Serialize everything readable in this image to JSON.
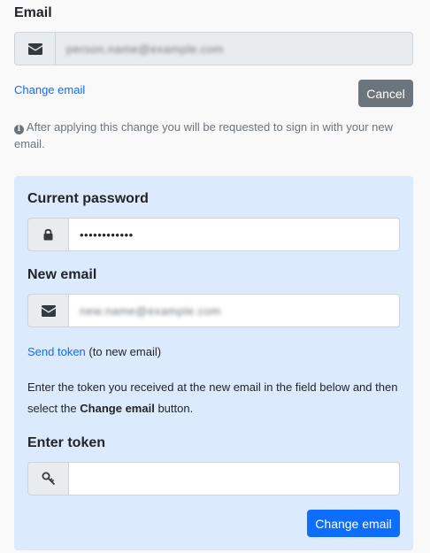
{
  "email_section": {
    "label": "Email",
    "current_value": "person.name@example.com",
    "change_link": "Change email",
    "cancel_button": "Cancel",
    "info_text": "After applying this change you will be requested to sign in with your new email."
  },
  "panel": {
    "password_label": "Current password",
    "password_value": "••••••••••••",
    "new_email_label": "New email",
    "new_email_value": "new.name@example.com",
    "send_token_link": "Send token",
    "send_token_hint": "(to new email)",
    "instruction_pre": "Enter the token you received at the new email in the field below and then select the",
    "instruction_bold": "Change email",
    "instruction_post": "button.",
    "token_label": "Enter token",
    "token_value": "",
    "submit_button": "Change email"
  },
  "colors": {
    "panel_bg": "#dbeafc",
    "primary": "#0d6efd",
    "secondary": "#6c757d"
  },
  "icons": [
    "envelope-icon",
    "info-icon",
    "lock-icon",
    "key-icon"
  ]
}
